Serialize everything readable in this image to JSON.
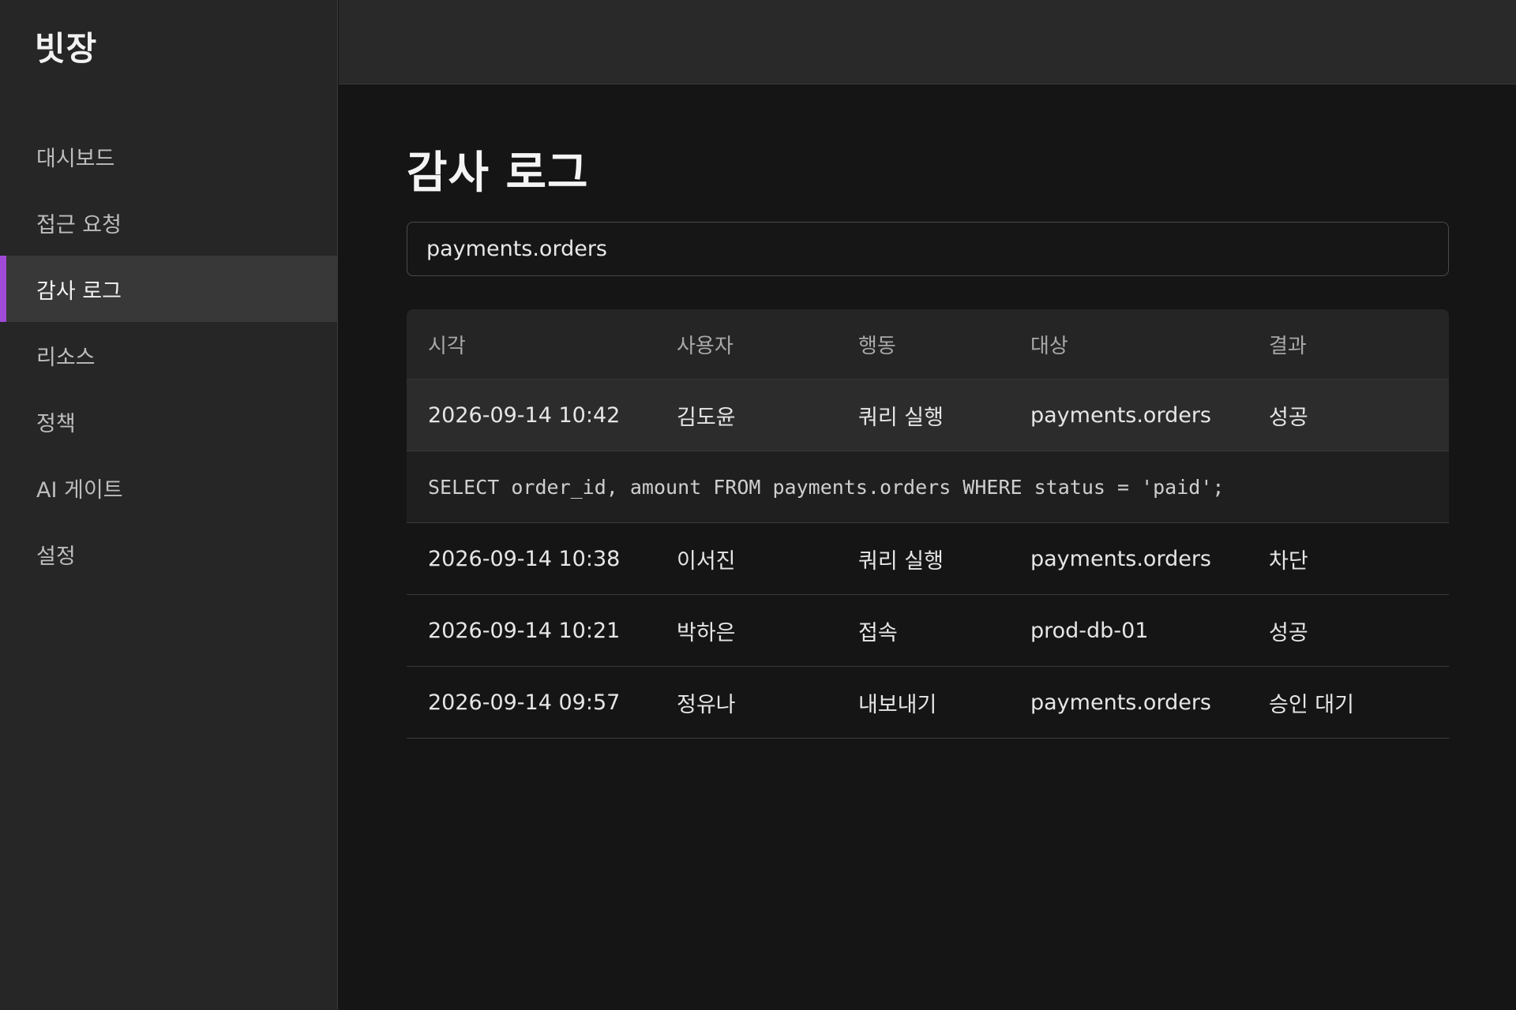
{
  "app": {
    "brand": "빗장"
  },
  "sidebar": {
    "items": [
      {
        "label": "대시보드",
        "active": false
      },
      {
        "label": "접근 요청",
        "active": false
      },
      {
        "label": "감사 로그",
        "active": true
      },
      {
        "label": "리소스",
        "active": false
      },
      {
        "label": "정책",
        "active": false
      },
      {
        "label": "AI 게이트",
        "active": false
      },
      {
        "label": "설정",
        "active": false
      }
    ],
    "accent_color": "#a24ad8"
  },
  "main": {
    "title": "감사 로그",
    "search": {
      "value": "payments.orders",
      "placeholder": ""
    },
    "table": {
      "headers": [
        "시각",
        "사용자",
        "행동",
        "대상",
        "결과"
      ],
      "rows": [
        {
          "time": "2026-09-14 10:42",
          "user": "김도윤",
          "action": "쿼리 실행",
          "target": "payments.orders",
          "result": "성공",
          "selected": true
        },
        {
          "time": "2026-09-14 10:38",
          "user": "이서진",
          "action": "쿼리 실행",
          "target": "payments.orders",
          "result": "차단"
        },
        {
          "time": "2026-09-14 10:21",
          "user": "박하은",
          "action": "접속",
          "target": "prod-db-01",
          "result": "성공"
        },
        {
          "time": "2026-09-14 09:57",
          "user": "정유나",
          "action": "내보내기",
          "target": "payments.orders",
          "result": "승인 대기"
        }
      ],
      "expanded_detail": "SELECT order_id, amount FROM payments.orders WHERE status = 'paid';"
    }
  }
}
